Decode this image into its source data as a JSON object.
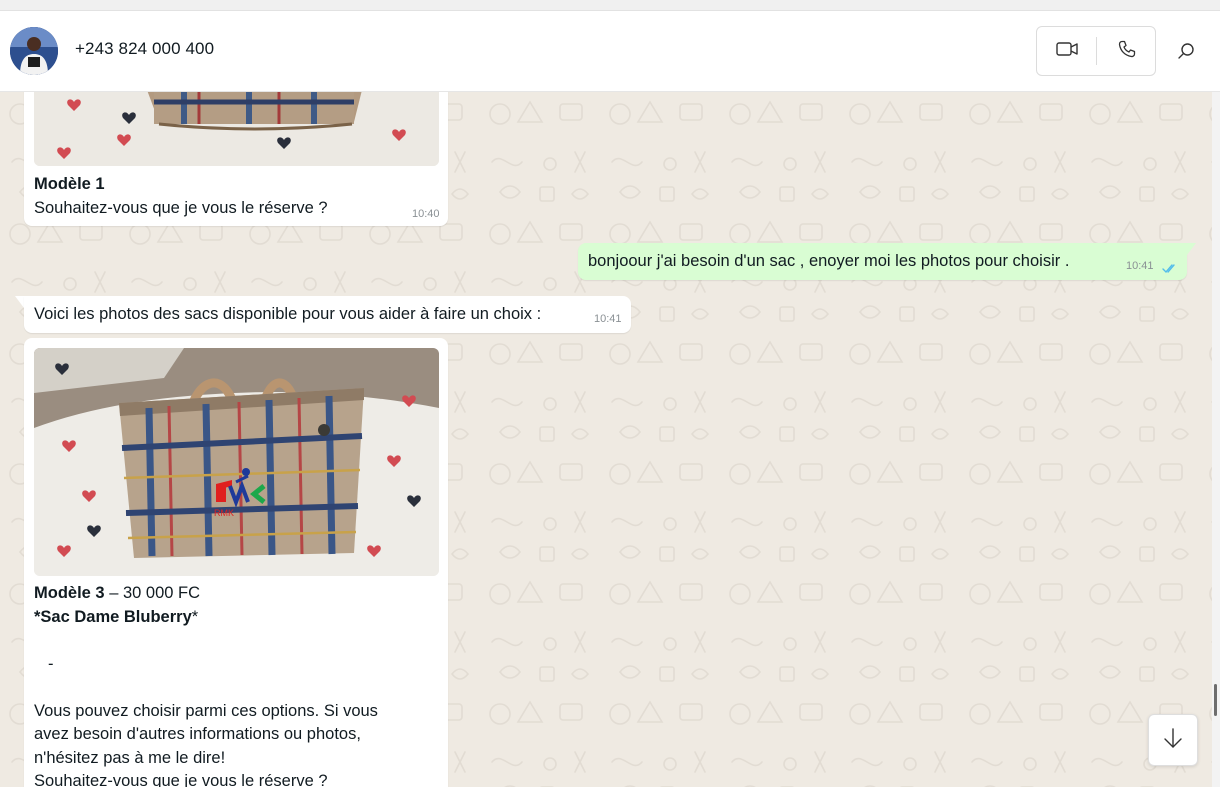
{
  "header": {
    "contact_name": "+243 824 000 400",
    "icons": [
      "video-call-icon",
      "voice-call-icon",
      "search-icon"
    ]
  },
  "messages": [
    {
      "direction": "incoming",
      "type": "image",
      "caption_title": "Modèle 1",
      "caption_body": "Souhaitez-vous que je vous le réserve ?",
      "time": "10:40"
    },
    {
      "direction": "outgoing",
      "type": "text",
      "text": "bonjoour j'ai besoin d'un sac , enoyer moi les photos pour choisir .",
      "time": "10:41",
      "status": "read"
    },
    {
      "direction": "incoming",
      "type": "text",
      "text": "Voici les photos des sacs disponible pour vous aider à faire un choix :",
      "time": "10:41"
    },
    {
      "direction": "incoming",
      "type": "image",
      "watermark": "RMK",
      "caption_model": "Modèle 3",
      "caption_price": " – 30 000 FC",
      "caption_name_prefix": "*",
      "caption_name": "Sac Dame Bluberry",
      "caption_name_suffix": "*",
      "caption_dash": "-",
      "caption_lines": [
        "Vous pouvez choisir parmi ces options. Si vous",
        "avez besoin d'autres informations ou photos,",
        "n'hésitez pas à me le dire!",
        "Souhaitez-vous que je vous le réserve ?"
      ]
    }
  ],
  "colors": {
    "incoming_bubble": "#ffffff",
    "outgoing_bubble": "#d9fdd3",
    "chat_background": "#efeae2",
    "read_ticks": "#53bdeb"
  }
}
